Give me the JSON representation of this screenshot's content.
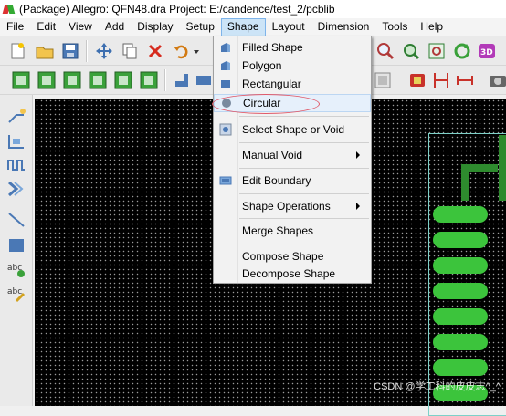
{
  "window": {
    "title": "(Package) Allegro: QFN48.dra  Project: E:/candence/test_2/pcblib"
  },
  "menubar": {
    "items": [
      {
        "label": "File"
      },
      {
        "label": "Edit"
      },
      {
        "label": "View"
      },
      {
        "label": "Add"
      },
      {
        "label": "Display"
      },
      {
        "label": "Setup"
      },
      {
        "label": "Shape"
      },
      {
        "label": "Layout"
      },
      {
        "label": "Dimension"
      },
      {
        "label": "Tools"
      },
      {
        "label": "Help"
      }
    ],
    "active": "Shape"
  },
  "shape_menu": {
    "items": [
      {
        "label": "Filled Shape",
        "icon": "filled-shape-icon"
      },
      {
        "label": "Polygon",
        "icon": "polygon-icon"
      },
      {
        "label": "Rectangular",
        "icon": "rectangular-icon"
      },
      {
        "label": "Circular",
        "icon": "circular-icon"
      },
      {
        "label": "Select Shape or Void",
        "icon": "select-shape-icon"
      },
      {
        "label": "Manual Void",
        "submenu": true
      },
      {
        "label": "Edit Boundary",
        "icon": "edit-boundary-icon"
      },
      {
        "label": "Shape Operations",
        "submenu": true
      },
      {
        "label": "Merge Shapes"
      },
      {
        "label": "Compose Shape"
      },
      {
        "label": "Decompose Shape"
      }
    ],
    "highlighted": "Circular"
  },
  "colors": {
    "canvas_background": "#000000",
    "grid_dots": "#9a9a9a",
    "pad_fill": "#3cc43c",
    "board_outline": "#7dd1c8",
    "annotation_ellipse": "#e05a6a",
    "menu_highlight": "#cce4f7"
  },
  "watermark": "CSDN @学工科的皮皮志^_^"
}
